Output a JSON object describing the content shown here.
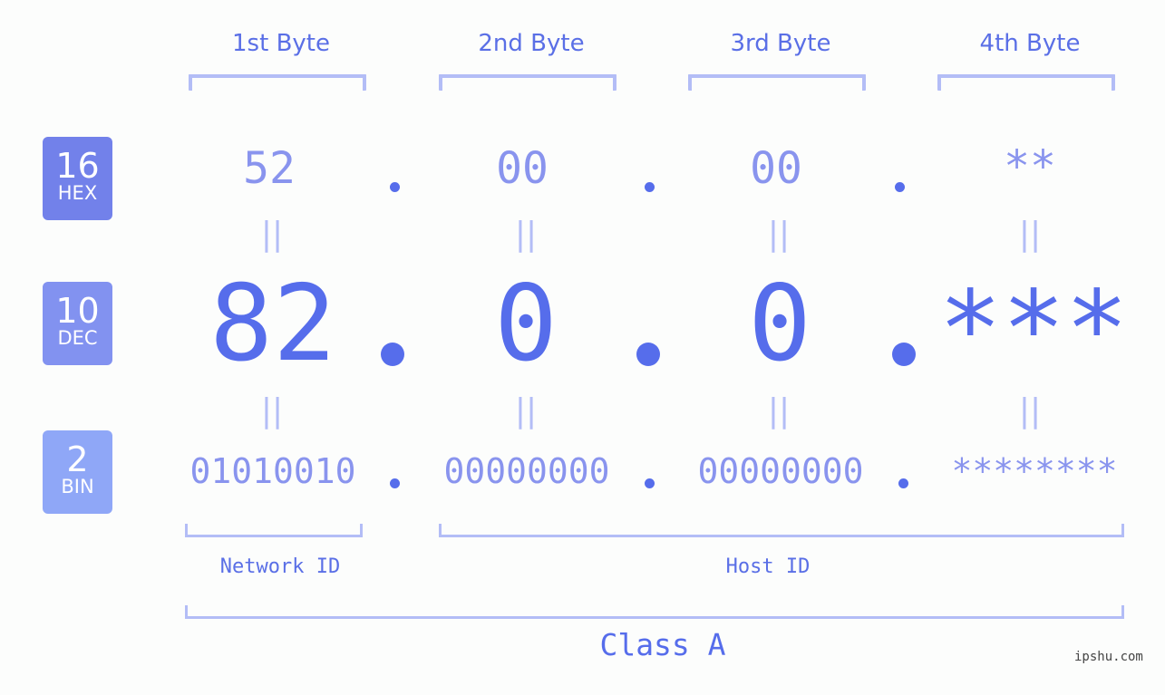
{
  "byte_headers": [
    "1st Byte",
    "2nd Byte",
    "3rd Byte",
    "4th Byte"
  ],
  "bases": [
    {
      "number": "16",
      "label": "HEX",
      "color": "#7281ea"
    },
    {
      "number": "10",
      "label": "DEC",
      "color": "#8292f0"
    },
    {
      "number": "2",
      "label": "BIN",
      "color": "#8fa7f7"
    }
  ],
  "hex_values": [
    "52",
    "00",
    "00",
    "**"
  ],
  "dec_values": [
    "82",
    "0",
    "0",
    "***"
  ],
  "bin_values": [
    "01010010",
    "00000000",
    "00000000",
    "********"
  ],
  "equals_symbol": "||",
  "separator": ".",
  "network_id_label": "Network ID",
  "host_id_label": "Host ID",
  "class_label": "Class A",
  "watermark": "ipshu.com",
  "colors": {
    "accent": "#566deb",
    "light_accent": "#8994ee",
    "bracket": "#b3bdf6"
  }
}
